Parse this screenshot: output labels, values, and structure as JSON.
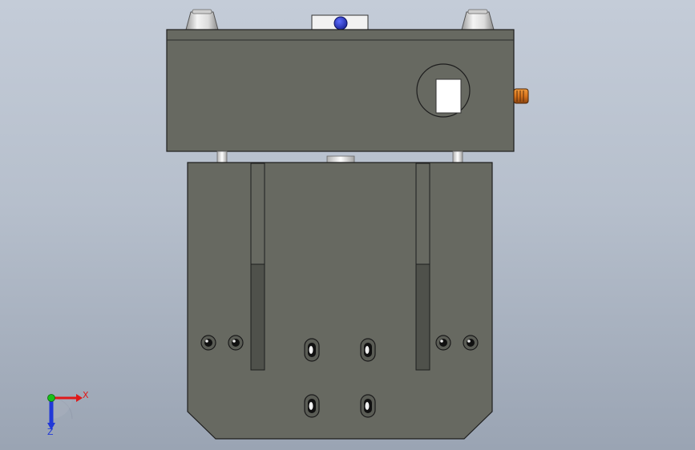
{
  "viewport": {
    "background_top": "#c4ccd8",
    "background_bottom": "#9aa4b3"
  },
  "colors": {
    "body_gray": "#676961",
    "slot_dark": "#4f514b",
    "outline": "#1e1e1e",
    "light_part": "#e8e8e8",
    "blue_knob": "#1f2fb8",
    "orange_connector": "#d8741c"
  },
  "triad": {
    "x_label": "X",
    "z_label": "Z",
    "x_color": "#e01818",
    "y_color": "#18c018",
    "z_color": "#2038d8"
  }
}
